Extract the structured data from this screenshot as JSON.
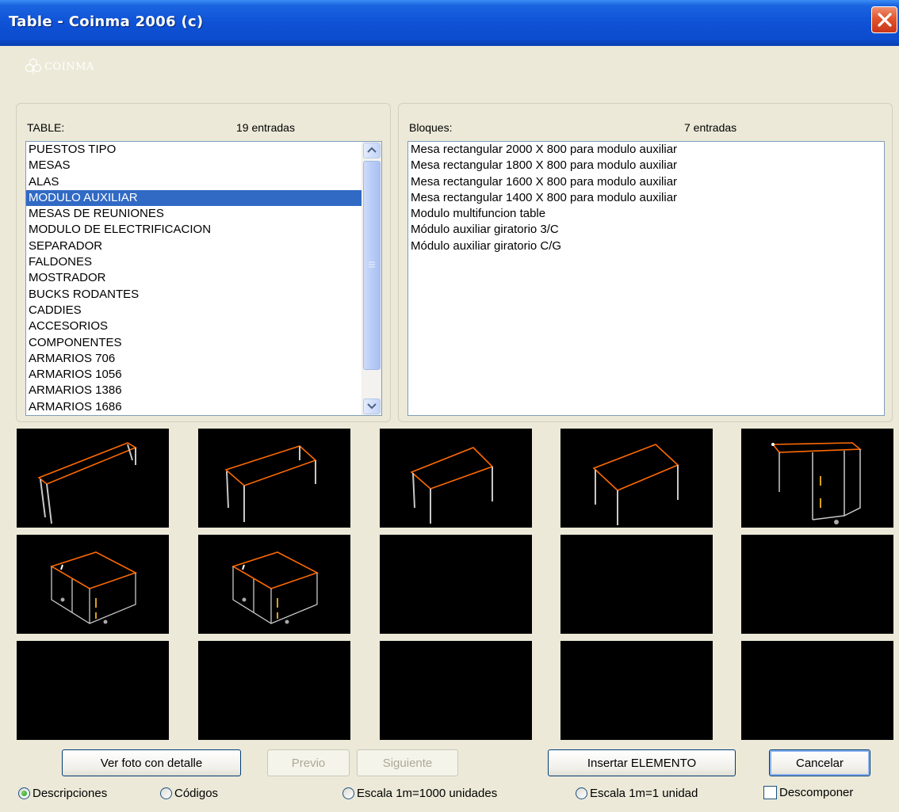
{
  "window": {
    "title": "Table - Coinma 2006 (c)"
  },
  "logo": {
    "text": "COINMA"
  },
  "left_panel": {
    "label": "TABLE:",
    "count": "19 entradas",
    "items": [
      "PUESTOS TIPO",
      "MESAS",
      "ALAS",
      "MODULO AUXILIAR",
      "MESAS DE REUNIONES",
      "MODULO DE ELECTRIFICACION",
      "SEPARADOR",
      "FALDONES",
      "MOSTRADOR",
      "BUCKS RODANTES",
      "CADDIES",
      "ACCESORIOS",
      "COMPONENTES",
      "ARMARIOS 706",
      "ARMARIOS 1056",
      "ARMARIOS 1386",
      "ARMARIOS 1686"
    ],
    "selected_item": "MODULO AUXILIAR"
  },
  "right_panel": {
    "label": "Bloques:",
    "count": "7 entradas",
    "items": [
      "Mesa rectangular 2000 X 800 para modulo auxiliar",
      "Mesa rectangular 1800 X 800 para modulo auxiliar",
      "Mesa rectangular 1600 X 800 para modulo auxiliar",
      "Mesa rectangular 1400 X 800 para modulo auxiliar",
      "Modulo multifuncion table",
      "Módulo auxiliar giratorio 3/C",
      "Módulo auxiliar giratorio C/G"
    ]
  },
  "thumbnails": {
    "count": 15,
    "filled": 7
  },
  "buttons": {
    "ver_foto": "Ver foto con detalle",
    "previo": "Previo",
    "siguiente": "Siguiente",
    "insertar": "Insertar ELEMENTO",
    "cancelar": "Cancelar"
  },
  "options": {
    "descripciones": "Descripciones",
    "codigos": "Códigos",
    "escala_1000": "Escala 1m=1000 unidades",
    "escala_1": "Escala 1m=1 unidad",
    "descomponer": "Descomponer"
  },
  "colors": {
    "titlebar": "#0c4ccd",
    "selection": "#316ac5",
    "face": "#ece9d8",
    "drawing_edge": "#ff6a00",
    "drawing_line": "#c8c8c8"
  }
}
